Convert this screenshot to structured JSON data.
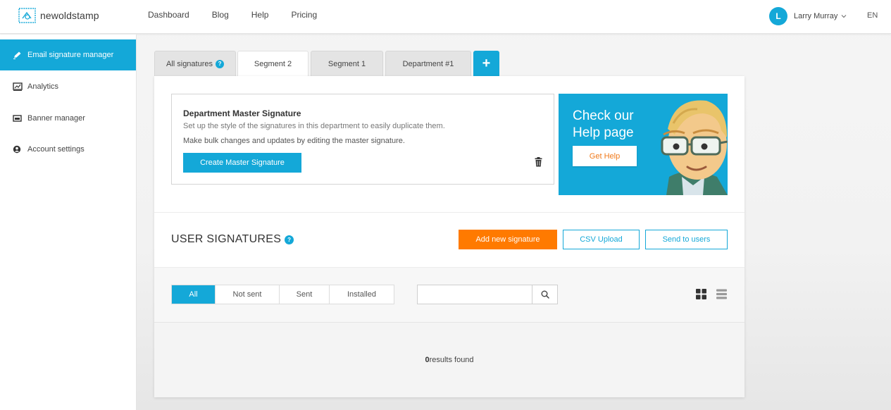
{
  "brand": {
    "name": "newoldstamp"
  },
  "nav": [
    {
      "label": "Dashboard"
    },
    {
      "label": "Blog"
    },
    {
      "label": "Help"
    },
    {
      "label": "Pricing"
    }
  ],
  "user": {
    "initial": "L",
    "name": "Larry Murray"
  },
  "language": "EN",
  "sidebar": {
    "items": [
      {
        "label": "Email signature manager",
        "icon": "pen-icon",
        "active": true
      },
      {
        "label": "Analytics",
        "icon": "chart-icon"
      },
      {
        "label": "Banner manager",
        "icon": "banner-icon"
      },
      {
        "label": "Account settings",
        "icon": "user-icon"
      }
    ]
  },
  "tabs": [
    {
      "label": "All signatures"
    },
    {
      "label": "Segment 2",
      "active": true
    },
    {
      "label": "Segment 1"
    },
    {
      "label": "Department #1"
    }
  ],
  "tab_add_label": "+",
  "master": {
    "title": "Department Master Signature",
    "line1": "Set up the style of the signatures in this department to easily duplicate them.",
    "line2": "Make bulk changes and updates by editing the master signature.",
    "button": "Create Master Signature"
  },
  "help_card": {
    "title": "Check our Help page",
    "button": "Get Help",
    "accent": "#14a8d8",
    "button_text_color": "#f07a1a"
  },
  "signatures": {
    "title": "USER SIGNATURES",
    "add_button": "Add new signature",
    "csv_button": "CSV Upload",
    "send_button": "Send to users",
    "add_color": "#ff7a00"
  },
  "filters": [
    {
      "label": "All",
      "active": true
    },
    {
      "label": "Not sent"
    },
    {
      "label": "Sent"
    },
    {
      "label": "Installed"
    }
  ],
  "search": {
    "value": "",
    "placeholder": ""
  },
  "results": {
    "count": "0",
    "text": "results found"
  },
  "help_badge": "?"
}
